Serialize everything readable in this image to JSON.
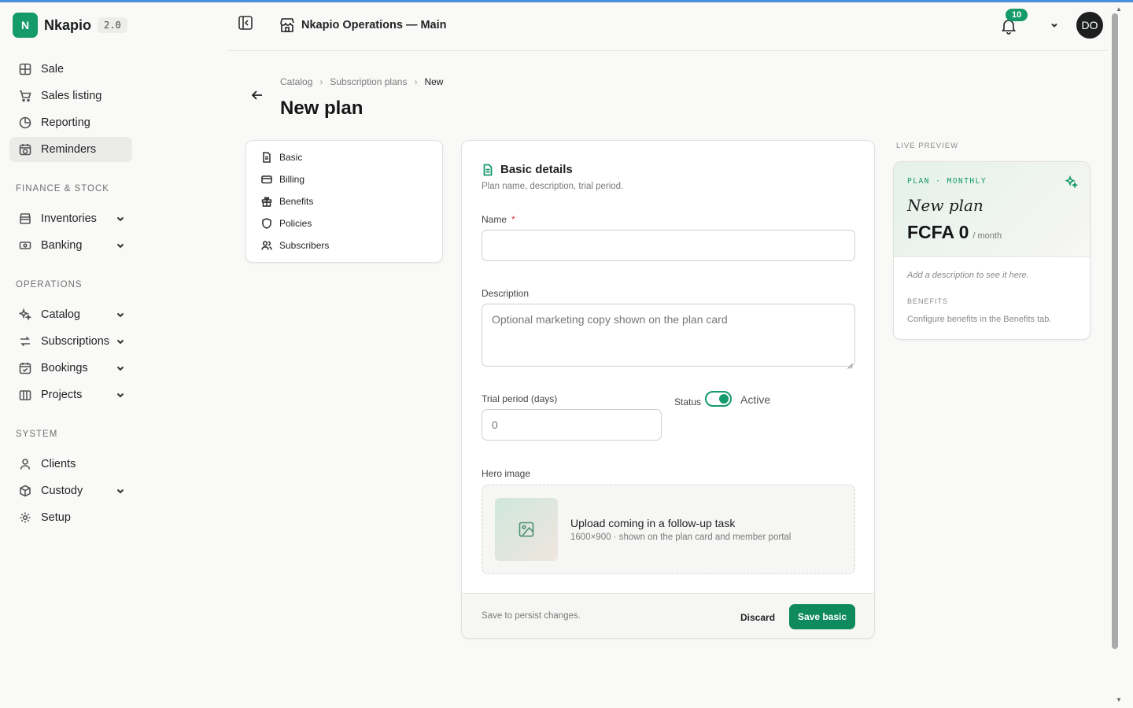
{
  "brand": {
    "logo_letter": "N",
    "name": "Nkapio",
    "version": "2.0"
  },
  "sidebar": {
    "items_top": [
      {
        "label": "Sale",
        "icon": "grid-icon"
      },
      {
        "label": "Sales listing",
        "icon": "cart-icon"
      },
      {
        "label": "Reporting",
        "icon": "pie-icon"
      },
      {
        "label": "Reminders",
        "icon": "calendar-clock-icon",
        "active": true
      }
    ],
    "section_finance": "FINANCE & STOCK",
    "items_finance": [
      {
        "label": "Inventories",
        "icon": "store-icon",
        "expandable": true
      },
      {
        "label": "Banking",
        "icon": "banknote-icon",
        "expandable": true
      }
    ],
    "section_operations": "OPERATIONS",
    "items_operations": [
      {
        "label": "Catalog",
        "icon": "sparkles-icon",
        "expandable": true
      },
      {
        "label": "Subscriptions",
        "icon": "repeat-icon",
        "expandable": true
      },
      {
        "label": "Bookings",
        "icon": "calendar-check-icon",
        "expandable": true
      },
      {
        "label": "Projects",
        "icon": "columns-icon",
        "expandable": true
      }
    ],
    "section_system": "SYSTEM",
    "items_system": [
      {
        "label": "Clients",
        "icon": "user-icon"
      },
      {
        "label": "Custody",
        "icon": "box-icon",
        "expandable": true
      },
      {
        "label": "Setup",
        "icon": "gear-icon"
      }
    ]
  },
  "header": {
    "store_name": "Nkapio Operations — Main",
    "notification_count": "10",
    "avatar_initials": "DO"
  },
  "breadcrumb": {
    "items": [
      "Catalog",
      "Subscription plans"
    ],
    "current": "New"
  },
  "page_title": "New plan",
  "section_nav": [
    "Basic",
    "Billing",
    "Benefits",
    "Policies",
    "Subscribers"
  ],
  "form": {
    "title": "Basic details",
    "subtitle": "Plan name, description, trial period.",
    "name_label": "Name",
    "required_mark": "*",
    "name_value": "",
    "description_label": "Description",
    "description_placeholder": "Optional marketing copy shown on the plan card",
    "trial_label": "Trial period (days)",
    "trial_value": "0",
    "status_label": "Status",
    "status_value": "Active",
    "status_on": true,
    "hero_label": "Hero image",
    "upload_title": "Upload coming in a follow-up task",
    "upload_sub": "1600×900 · shown on the plan card and member portal",
    "footer_note": "Save to persist changes.",
    "discard_label": "Discard",
    "save_label": "Save basic"
  },
  "preview": {
    "label": "LIVE PREVIEW",
    "meta": "PLAN · MONTHLY",
    "plan_name": "New plan",
    "price": "FCFA 0",
    "period": "/ month",
    "description_placeholder": "Add a description to see it here.",
    "benefits_heading": "BENEFITS",
    "benefits_text": "Configure benefits in the Benefits tab."
  },
  "colors": {
    "accent": "#159a6b",
    "save_button": "#0f8a5f",
    "topline": "#4a90d9"
  }
}
